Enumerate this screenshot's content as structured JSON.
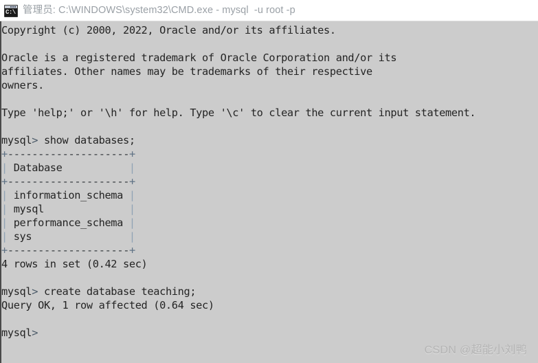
{
  "window": {
    "titlebar": {
      "icon": "cmd-console-icon",
      "icon_glyph": "C:\\.",
      "title": "管理员: C:\\WINDOWS\\system32\\CMD.exe - mysql  -u root -p"
    }
  },
  "console": {
    "background_color": "#cccccc",
    "foreground_color": "#242424",
    "pipe_color": "#8fa2b4",
    "lines": [
      "Copyright (c) 2000, 2022, Oracle and/or its affiliates.",
      "",
      "Oracle is a registered trademark of Oracle Corporation and/or its",
      "affiliates. Other names may be trademarks of their respective",
      "owners.",
      "",
      "Type 'help;' or '\\h' for help. Type '\\c' to clear the current input statement.",
      "",
      "mysql> show databases;",
      "+--------------------+",
      "| Database           |",
      "+--------------------+",
      "| information_schema |",
      "| mysql              |",
      "| performance_schema |",
      "| sys                |",
      "+--------------------+",
      "4 rows in set (0.42 sec)",
      "",
      "mysql> create database teaching;",
      "Query OK, 1 row affected (0.64 sec)",
      "",
      "mysql>"
    ],
    "prompt": "mysql>",
    "commands": [
      "show databases;",
      "create database teaching;"
    ],
    "result_table": {
      "columns": [
        "Database"
      ],
      "rows": [
        [
          "information_schema"
        ],
        [
          "mysql"
        ],
        [
          "performance_schema"
        ],
        [
          "sys"
        ]
      ],
      "row_count_status": "4 rows in set (0.42 sec)"
    },
    "statuses": [
      "4 rows in set (0.42 sec)",
      "Query OK, 1 row affected (0.64 sec)"
    ]
  },
  "watermark": {
    "text": "CSDN @超能小刘鸭",
    "color": "#b4b4b4"
  }
}
